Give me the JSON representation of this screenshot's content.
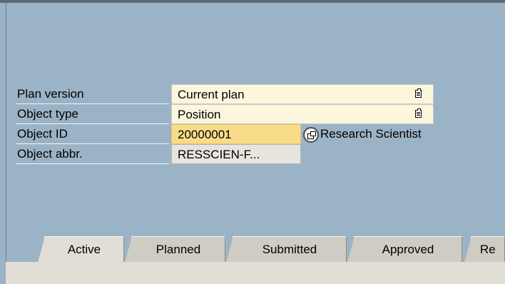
{
  "fields": {
    "plan_version": {
      "label": "Plan version",
      "value": "Current plan"
    },
    "object_type": {
      "label": "Object type",
      "value": "Position"
    },
    "object_id": {
      "label": "Object ID",
      "value": "20000001",
      "object_name": "Research Scientist"
    },
    "object_abbr": {
      "label": "Object abbr.",
      "value": "RESSCIEN-F..."
    }
  },
  "tabs": [
    {
      "label": "Active",
      "active": true
    },
    {
      "label": "Planned"
    },
    {
      "label": "Submitted"
    },
    {
      "label": "Approved"
    },
    {
      "label": "Re"
    }
  ],
  "icons": {
    "select": "list-select-icon",
    "matchcode": "matchcode-help-icon"
  }
}
